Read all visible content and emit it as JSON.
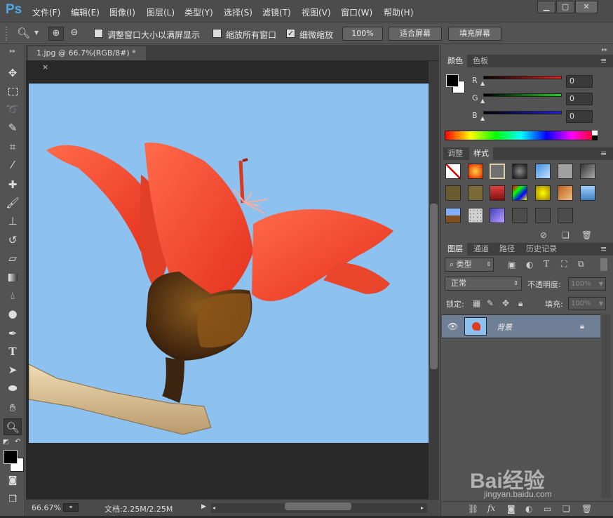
{
  "app": {
    "logo": "Ps",
    "accent": "#4fa8e8"
  },
  "menu": [
    "文件(F)",
    "编辑(E)",
    "图像(I)",
    "图层(L)",
    "类型(Y)",
    "选择(S)",
    "滤镜(T)",
    "视图(V)",
    "窗口(W)",
    "帮助(H)"
  ],
  "window_buttons": [
    "minimize",
    "restore",
    "close"
  ],
  "options": {
    "resize_windows": {
      "label": "调整窗口大小以满屏显示",
      "checked": false
    },
    "zoom_all": {
      "label": "缩放所有窗口",
      "checked": false
    },
    "scrubby_zoom": {
      "label": "细微缩放",
      "checked": true
    },
    "btn_100": "100%",
    "btn_fit": "适合屏幕",
    "btn_fill": "填充屏幕"
  },
  "tools": [
    "move-icon",
    "marquee-icon",
    "lasso-icon",
    "quick-selection-icon",
    "crop-icon",
    "eyedropper-icon",
    "healing-brush-icon",
    "brush-icon",
    "clone-stamp-icon",
    "history-brush-icon",
    "eraser-icon",
    "gradient-icon",
    "blur-icon",
    "dodge-icon",
    "pen-icon",
    "type-icon",
    "path-selection-icon",
    "ellipse-icon",
    "hand-icon",
    "zoom-icon"
  ],
  "document": {
    "tab_title": "1.jpg @ 66.7%(RGB/8#) *",
    "close": "×"
  },
  "status": {
    "zoom": "66.67%",
    "doc_size": "文档:2.25M/2.25M"
  },
  "color_panel": {
    "tabs": [
      "颜色",
      "色板"
    ],
    "channels": [
      {
        "label": "R",
        "value": "0",
        "color": "#e02020"
      },
      {
        "label": "G",
        "value": "0",
        "color": "#20d020"
      },
      {
        "label": "B",
        "value": "0",
        "color": "#2020e0"
      }
    ]
  },
  "styles_panel": {
    "tabs": [
      "调整",
      "样式"
    ]
  },
  "layers_panel": {
    "tabs": [
      "图层",
      "通道",
      "路径",
      "历史记录"
    ],
    "filter_label": "类型",
    "blend_mode": "正常",
    "opacity_label": "不透明度:",
    "opacity_value": "100%",
    "lock_label": "锁定:",
    "fill_label": "填充:",
    "fill_value": "100%",
    "layers": [
      {
        "name": "背景",
        "visible": true,
        "locked": true
      }
    ]
  },
  "watermark": {
    "text": "Bai经验",
    "sub": "jingyan.baidu.com"
  }
}
